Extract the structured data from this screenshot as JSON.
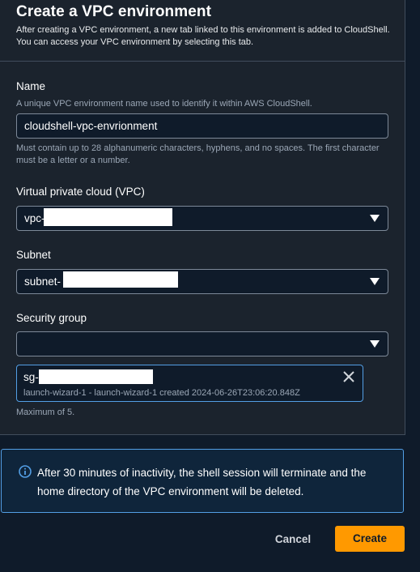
{
  "header": {
    "title": "Create a VPC environment",
    "subtitle": "After creating a VPC environment, a new tab linked to this environment is added to CloudShell. You can access your VPC environment by selecting this tab."
  },
  "name_field": {
    "label": "Name",
    "description": "A unique VPC environment name used to identify it within AWS CloudShell.",
    "value": "cloudshell-vpc-envrionment",
    "constraint": "Must contain up to 28 alphanumeric characters, hyphens, and no spaces. The first character must be a letter or a number."
  },
  "vpc_field": {
    "label": "Virtual private cloud (VPC)",
    "value": "vpc-"
  },
  "subnet_field": {
    "label": "Subnet",
    "value": "subnet-"
  },
  "security_group_field": {
    "label": "Security group",
    "value": "",
    "selected": {
      "label": "sg-",
      "detail": "launch-wizard-1 - launch-wizard-1 created 2024-06-26T23:06:20.848Z"
    },
    "constraint": "Maximum of 5."
  },
  "alert": {
    "icon": "info-icon",
    "text": "After 30 minutes of inactivity, the shell session will terminate and the home directory of the VPC environment will be deleted."
  },
  "footer": {
    "cancel_label": "Cancel",
    "create_label": "Create"
  },
  "colors": {
    "background": "#0f1b2a",
    "panel": "#1b232d",
    "accent": "#ff9900",
    "info_border": "#539fe5"
  }
}
